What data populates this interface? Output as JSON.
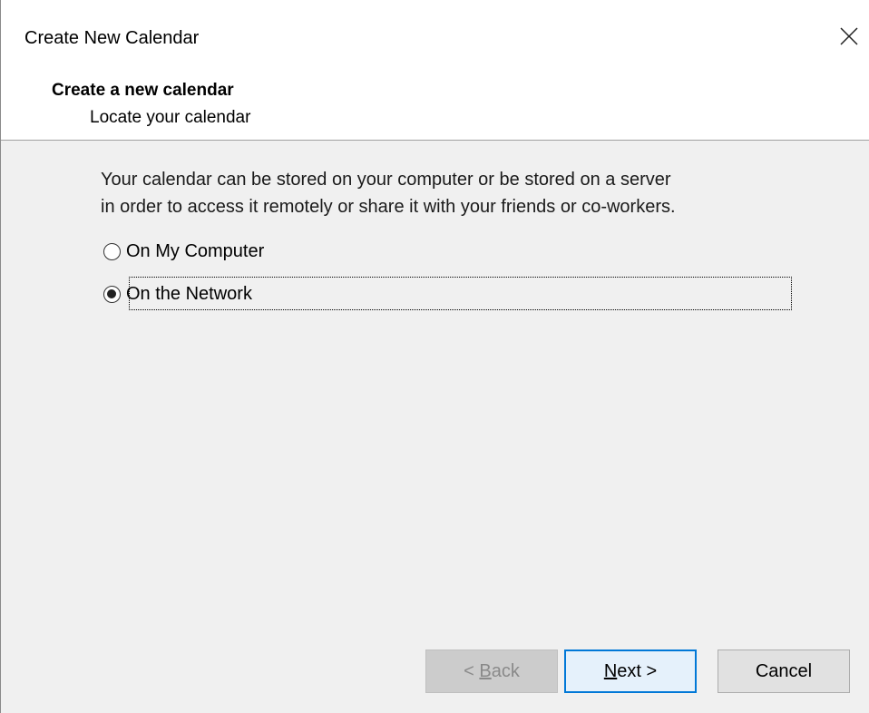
{
  "window": {
    "title": "Create New Calendar"
  },
  "header": {
    "title": "Create a new calendar",
    "subtitle": "Locate your calendar"
  },
  "content": {
    "description_line1": "Your calendar can be stored on your computer or be stored on a server",
    "description_line2": "in order to access it remotely or share it with your friends or co-workers.",
    "options": [
      {
        "label": "On My Computer",
        "selected": false
      },
      {
        "label": "On the Network",
        "selected": true
      }
    ]
  },
  "buttons": {
    "back_prefix": "< ",
    "back_mnemonic": "B",
    "back_rest": "ack",
    "back_enabled": false,
    "next_mnemonic": "N",
    "next_rest": "ext >",
    "cancel_label": "Cancel"
  },
  "colors": {
    "focus_border": "#0078d7",
    "dialog_background": "#f0f0f0",
    "header_background": "#ffffff"
  },
  "icons": {
    "close": "close-icon"
  }
}
